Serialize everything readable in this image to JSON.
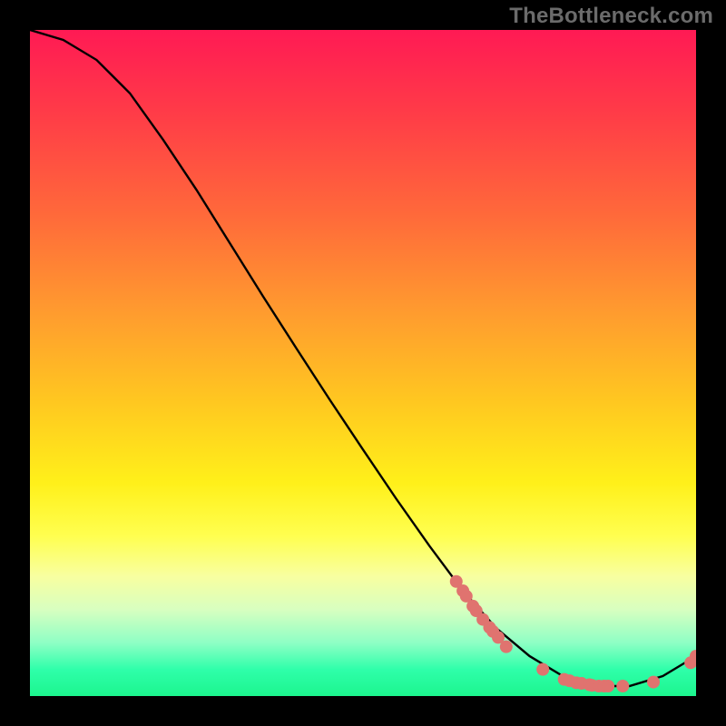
{
  "watermark": "TheBottleneck.com",
  "chart_data": {
    "type": "line",
    "title": "",
    "xlabel": "",
    "ylabel": "",
    "xlim": [
      0,
      1
    ],
    "ylim": [
      0,
      1
    ],
    "curve": [
      {
        "x": 0.0,
        "y": 1.0
      },
      {
        "x": 0.05,
        "y": 0.985
      },
      {
        "x": 0.1,
        "y": 0.955
      },
      {
        "x": 0.15,
        "y": 0.905
      },
      {
        "x": 0.2,
        "y": 0.835
      },
      {
        "x": 0.25,
        "y": 0.76
      },
      {
        "x": 0.3,
        "y": 0.68
      },
      {
        "x": 0.35,
        "y": 0.6
      },
      {
        "x": 0.4,
        "y": 0.522
      },
      {
        "x": 0.45,
        "y": 0.445
      },
      {
        "x": 0.5,
        "y": 0.37
      },
      {
        "x": 0.55,
        "y": 0.296
      },
      {
        "x": 0.6,
        "y": 0.225
      },
      {
        "x": 0.65,
        "y": 0.158
      },
      {
        "x": 0.7,
        "y": 0.102
      },
      {
        "x": 0.75,
        "y": 0.06
      },
      {
        "x": 0.8,
        "y": 0.03
      },
      {
        "x": 0.85,
        "y": 0.015
      },
      {
        "x": 0.9,
        "y": 0.015
      },
      {
        "x": 0.95,
        "y": 0.03
      },
      {
        "x": 1.0,
        "y": 0.06
      }
    ],
    "markers": [
      {
        "x": 0.64,
        "y": 0.172
      },
      {
        "x": 0.65,
        "y": 0.158
      },
      {
        "x": 0.655,
        "y": 0.15
      },
      {
        "x": 0.665,
        "y": 0.135
      },
      {
        "x": 0.67,
        "y": 0.128
      },
      {
        "x": 0.68,
        "y": 0.115
      },
      {
        "x": 0.69,
        "y": 0.103
      },
      {
        "x": 0.695,
        "y": 0.097
      },
      {
        "x": 0.703,
        "y": 0.088
      },
      {
        "x": 0.715,
        "y": 0.074
      },
      {
        "x": 0.77,
        "y": 0.04
      },
      {
        "x": 0.802,
        "y": 0.025
      },
      {
        "x": 0.81,
        "y": 0.023
      },
      {
        "x": 0.82,
        "y": 0.02
      },
      {
        "x": 0.828,
        "y": 0.019
      },
      {
        "x": 0.84,
        "y": 0.017
      },
      {
        "x": 0.844,
        "y": 0.016
      },
      {
        "x": 0.854,
        "y": 0.015
      },
      {
        "x": 0.862,
        "y": 0.015
      },
      {
        "x": 0.868,
        "y": 0.015
      },
      {
        "x": 0.89,
        "y": 0.015
      },
      {
        "x": 0.936,
        "y": 0.021
      },
      {
        "x": 0.992,
        "y": 0.05
      },
      {
        "x": 1.0,
        "y": 0.06
      }
    ],
    "marker_color": "#e0736f",
    "curve_color": "#000000"
  }
}
